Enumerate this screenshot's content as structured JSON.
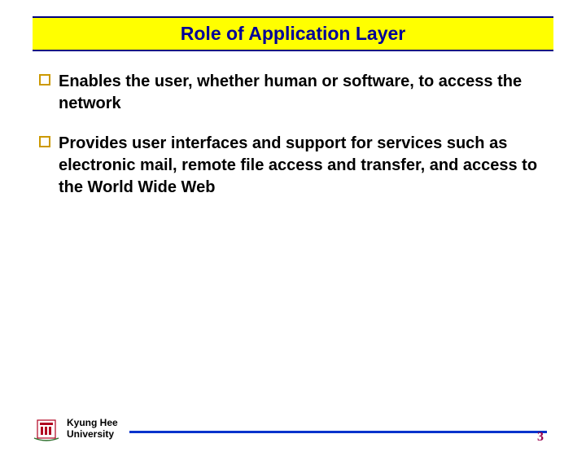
{
  "title": "Role of Application Layer",
  "bullets": [
    "Enables the user, whether human or software, to access the network",
    "Provides user interfaces and support  for services such as electronic mail, remote file access and transfer, and access to the World Wide Web"
  ],
  "footer": {
    "university_line1": "Kyung Hee",
    "university_line2": "University",
    "page_number": "3"
  }
}
